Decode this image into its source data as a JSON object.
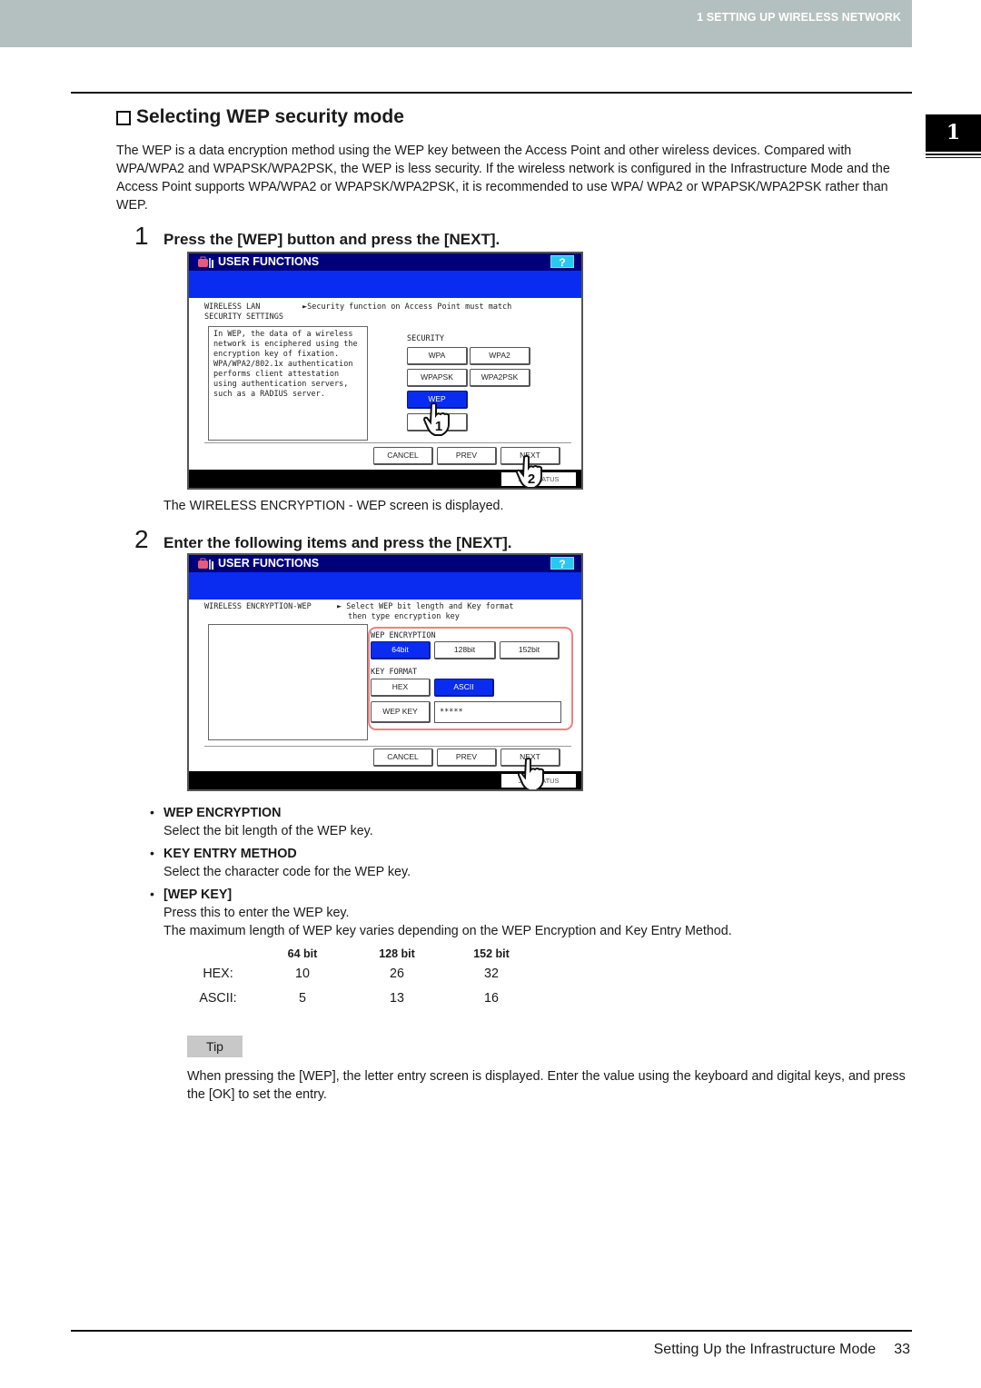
{
  "header": {
    "chapter_title": "1 SETTING UP WIRELESS NETWORK",
    "chapter_tab": "1"
  },
  "section": {
    "title": "Selecting WEP security mode",
    "intro": "The WEP is a data encryption method using the WEP key between the Access Point and other wireless devices. Compared with WPA/WPA2 and WPAPSK/WPA2PSK, the WEP is less security. If the wireless network is configured in the Infrastructure Mode and the Access Point supports WPA/WPA2 or WPAPSK/WPA2PSK, it is recommended to use WPA/ WPA2 or WPAPSK/WPA2PSK rather than WEP."
  },
  "step1": {
    "number": "1",
    "instruction": "Press the [WEP] button and press the [NEXT].",
    "caption": "The WIRELESS ENCRYPTION - WEP screen is displayed.",
    "screen": {
      "title": "USER FUNCTIONS",
      "help": "?",
      "heading_line1": "WIRELESS LAN",
      "heading_line2": "SECURITY SETTINGS",
      "hint": "►Security function on Access Point must match",
      "info": "In WEP, the data of a wireless network is enciphered using the encryption key of fixation. WPA/WPA2/802.1x authentication performs client attestation using authentication servers, such as a RADIUS server.",
      "security_label": "SECURITY",
      "options": [
        "WPA",
        "WPA2",
        "WPAPSK",
        "WPA2PSK",
        "WEP",
        "N"
      ],
      "selected": "WEP",
      "cancel": "CANCEL",
      "prev": "PREV",
      "next": "NEXT",
      "job_status": "JOB STATUS",
      "callouts": [
        "1",
        "2"
      ]
    }
  },
  "step2": {
    "number": "2",
    "instruction": "Enter the following items and press the [NEXT].",
    "screen": {
      "title": "USER FUNCTIONS",
      "help": "?",
      "heading": "WIRELESS ENCRYPTION-WEP",
      "hint_line1": "► Select WEP bit length and Key format",
      "hint_line2": "then type encryption key",
      "wep_encryption_label": "WEP ENCRYPTION",
      "bit_options": [
        "64bit",
        "128bit",
        "152bit"
      ],
      "bit_selected": "64bit",
      "key_format_label": "KEY FORMAT",
      "format_options": [
        "HEX",
        "ASCII"
      ],
      "format_selected": "ASCII",
      "wep_key_button": "WEP KEY",
      "wep_key_value": "*****",
      "cancel": "CANCEL",
      "prev": "PREV",
      "next": "NEXT",
      "job_status": "JOB STATUS"
    }
  },
  "bullets": [
    {
      "head": "WEP ENCRYPTION",
      "body": [
        "Select the bit length of the WEP key."
      ]
    },
    {
      "head": "KEY ENTRY METHOD",
      "body": [
        "Select the character code for the WEP key."
      ]
    },
    {
      "head": "[WEP KEY]",
      "body": [
        "Press this to enter the WEP key.",
        "The maximum length of WEP key varies depending on the WEP Encryption and Key Entry Method."
      ]
    }
  ],
  "key_length_table": {
    "columns": [
      "",
      "64 bit",
      "128 bit",
      "152 bit"
    ],
    "rows": [
      [
        "HEX:",
        "10",
        "26",
        "32"
      ],
      [
        "ASCII:",
        "5",
        "13",
        "16"
      ]
    ]
  },
  "tip": {
    "label": "Tip",
    "text": "When pressing the [WEP], the letter entry screen is displayed. Enter the value using the keyboard and digital keys, and press the [OK] to set the entry."
  },
  "footer": {
    "section_name": "Setting Up the Infrastructure Mode",
    "page_number": "33"
  }
}
